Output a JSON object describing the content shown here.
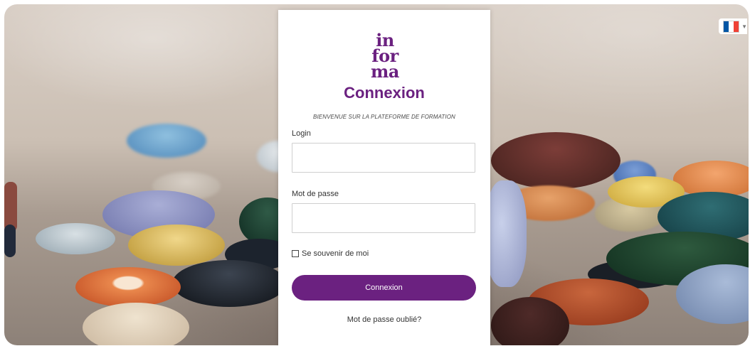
{
  "brand": {
    "logo_lines": [
      "in",
      "for",
      "ma"
    ],
    "color": "#6b2180"
  },
  "login_form": {
    "title": "Connexion",
    "welcome": "BIENVENUE SUR LA PLATEFORME DE FORMATION",
    "login_label": "Login",
    "login_value": "",
    "password_label": "Mot de passe",
    "password_value": "",
    "remember_label": "Se souvenir de moi",
    "remember_checked": false,
    "submit_label": "Connexion",
    "forgot_label": "Mot de passe oublié?"
  },
  "language": {
    "selected_flag": "france-flag-icon",
    "flag_colors": [
      "#0055a4",
      "#ffffff",
      "#ef4135"
    ]
  }
}
